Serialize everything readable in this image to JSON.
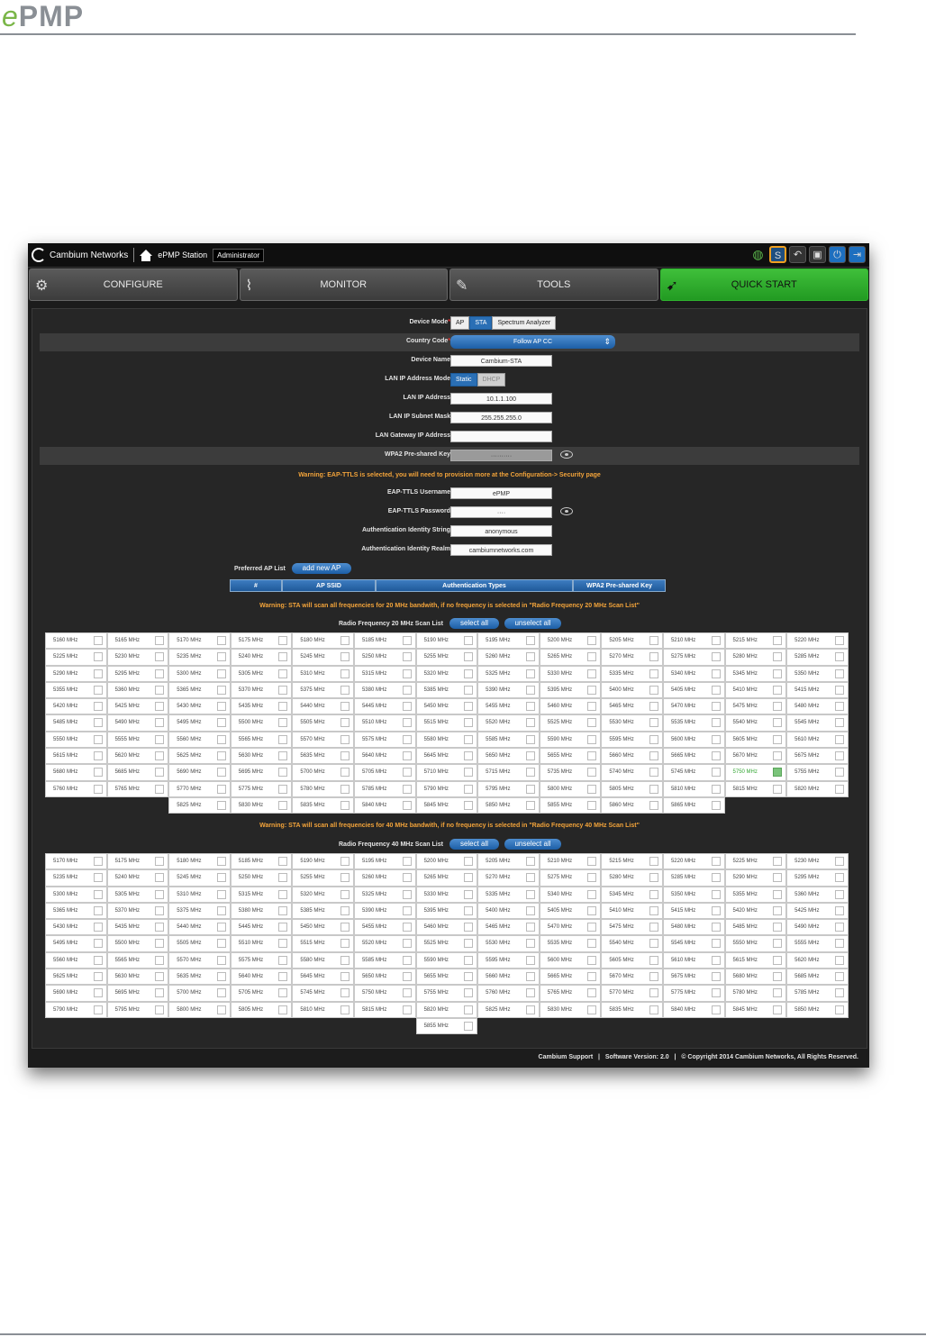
{
  "doc": {
    "logo_e": "e",
    "logo_rest": "PMP"
  },
  "topbar": {
    "brand": "Cambium Networks",
    "station": "ePMP Station",
    "role": "Administrator",
    "bulb_badge": "S"
  },
  "tabs": [
    {
      "label": "CONFIGURE"
    },
    {
      "label": "MONITOR"
    },
    {
      "label": "TOOLS"
    },
    {
      "label": "QUICK START"
    }
  ],
  "form": {
    "device_mode_label": "Device Mode",
    "device_mode_options": [
      "AP",
      "STA",
      "Spectrum Analyzer"
    ],
    "country_code_label": "Country Code",
    "country_code_value": "Follow AP CC",
    "device_name_label": "Device Name",
    "device_name_value": "Cambium-STA",
    "lan_mode_label": "LAN IP Address Mode",
    "lan_mode_options": [
      "Static",
      "DHCP"
    ],
    "lan_ip_label": "LAN IP Address",
    "lan_ip_value": "10.1.1.100",
    "subnet_label": "LAN IP Subnet Mask",
    "subnet_value": "255.255.255.0",
    "gateway_label": "LAN Gateway IP Address",
    "gateway_value": "",
    "psk_label": "WPA2 Pre-shared Key",
    "psk_value": "··········",
    "warning_eap": "Warning: EAP-TTLS is selected, you will need to provision more at the Configuration-> Security page",
    "eap_user_label": "EAP-TTLS Username",
    "eap_user_value": "ePMP",
    "eap_pass_label": "EAP-TTLS Password",
    "eap_pass_value": "····",
    "auth_id_label": "Authentication Identity String",
    "auth_id_value": "anonymous",
    "auth_realm_label": "Authentication Identity Realm",
    "auth_realm_value": "cambiumnetworks.com"
  },
  "preferred": {
    "label": "Preferred AP List",
    "add_button": "add new AP",
    "headers": [
      "#",
      "AP SSID",
      "Authentication Types",
      "WPA2 Pre-shared Key"
    ]
  },
  "scan20": {
    "warning": "Warning: STA will scan all frequencies for 20 MHz bandwith, if no frequency is selected in \"Radio Frequency 20 MHz Scan List\"",
    "title": "Radio Frequency 20 MHz Scan List",
    "select_all": "select all",
    "unselect_all": "unselect all",
    "selected": "5750 MHz",
    "rows": [
      [
        "5160 MHz",
        "5165 MHz",
        "5170 MHz",
        "5175 MHz",
        "5180 MHz",
        "5185 MHz",
        "5190 MHz",
        "5195 MHz",
        "5200 MHz",
        "5205 MHz",
        "5210 MHz",
        "5215 MHz",
        "5220 MHz"
      ],
      [
        "5225 MHz",
        "5230 MHz",
        "5235 MHz",
        "5240 MHz",
        "5245 MHz",
        "5250 MHz",
        "5255 MHz",
        "5260 MHz",
        "5265 MHz",
        "5270 MHz",
        "5275 MHz",
        "5280 MHz",
        "5285 MHz"
      ],
      [
        "5290 MHz",
        "5295 MHz",
        "5300 MHz",
        "5305 MHz",
        "5310 MHz",
        "5315 MHz",
        "5320 MHz",
        "5325 MHz",
        "5330 MHz",
        "5335 MHz",
        "5340 MHz",
        "5345 MHz",
        "5350 MHz"
      ],
      [
        "5355 MHz",
        "5360 MHz",
        "5365 MHz",
        "5370 MHz",
        "5375 MHz",
        "5380 MHz",
        "5385 MHz",
        "5390 MHz",
        "5395 MHz",
        "5400 MHz",
        "5405 MHz",
        "5410 MHz",
        "5415 MHz"
      ],
      [
        "5420 MHz",
        "5425 MHz",
        "5430 MHz",
        "5435 MHz",
        "5440 MHz",
        "5445 MHz",
        "5450 MHz",
        "5455 MHz",
        "5460 MHz",
        "5465 MHz",
        "5470 MHz",
        "5475 MHz",
        "5480 MHz"
      ],
      [
        "5485 MHz",
        "5490 MHz",
        "5495 MHz",
        "5500 MHz",
        "5505 MHz",
        "5510 MHz",
        "5515 MHz",
        "5520 MHz",
        "5525 MHz",
        "5530 MHz",
        "5535 MHz",
        "5540 MHz",
        "5545 MHz"
      ],
      [
        "5550 MHz",
        "5555 MHz",
        "5560 MHz",
        "5565 MHz",
        "5570 MHz",
        "5575 MHz",
        "5580 MHz",
        "5585 MHz",
        "5590 MHz",
        "5595 MHz",
        "5600 MHz",
        "5605 MHz",
        "5610 MHz"
      ],
      [
        "5615 MHz",
        "5620 MHz",
        "5625 MHz",
        "5630 MHz",
        "5635 MHz",
        "5640 MHz",
        "5645 MHz",
        "5650 MHz",
        "5655 MHz",
        "5660 MHz",
        "5665 MHz",
        "5670 MHz",
        "5675 MHz"
      ],
      [
        "5680 MHz",
        "5685 MHz",
        "5690 MHz",
        "5695 MHz",
        "5700 MHz",
        "5705 MHz",
        "5710 MHz",
        "5715 MHz",
        "5735 MHz",
        "5740 MHz",
        "5745 MHz",
        "5750 MHz",
        "5755 MHz"
      ],
      [
        "5760 MHz",
        "5765 MHz",
        "5770 MHz",
        "5775 MHz",
        "5780 MHz",
        "5785 MHz",
        "5790 MHz",
        "5795 MHz",
        "5800 MHz",
        "5805 MHz",
        "5810 MHz",
        "5815 MHz",
        "5820 MHz"
      ],
      [
        "",
        "",
        "5825 MHz",
        "5830 MHz",
        "5835 MHz",
        "5840 MHz",
        "5845 MHz",
        "5850 MHz",
        "5855 MHz",
        "5860 MHz",
        "5865 MHz",
        "",
        ""
      ]
    ]
  },
  "scan40": {
    "warning": "Warning: STA will scan all frequencies for 40 MHz bandwith, if no frequency is selected in \"Radio Frequency 40 MHz Scan List\"",
    "title": "Radio Frequency 40 MHz Scan List",
    "select_all": "select all",
    "unselect_all": "unselect all",
    "rows": [
      [
        "5170 MHz",
        "5175 MHz",
        "5180 MHz",
        "5185 MHz",
        "5190 MHz",
        "5195 MHz",
        "5200 MHz",
        "5205 MHz",
        "5210 MHz",
        "5215 MHz",
        "5220 MHz",
        "5225 MHz",
        "5230 MHz"
      ],
      [
        "5235 MHz",
        "5240 MHz",
        "5245 MHz",
        "5250 MHz",
        "5255 MHz",
        "5260 MHz",
        "5265 MHz",
        "5270 MHz",
        "5275 MHz",
        "5280 MHz",
        "5285 MHz",
        "5290 MHz",
        "5295 MHz"
      ],
      [
        "5300 MHz",
        "5305 MHz",
        "5310 MHz",
        "5315 MHz",
        "5320 MHz",
        "5325 MHz",
        "5330 MHz",
        "5335 MHz",
        "5340 MHz",
        "5345 MHz",
        "5350 MHz",
        "5355 MHz",
        "5360 MHz"
      ],
      [
        "5365 MHz",
        "5370 MHz",
        "5375 MHz",
        "5380 MHz",
        "5385 MHz",
        "5390 MHz",
        "5395 MHz",
        "5400 MHz",
        "5405 MHz",
        "5410 MHz",
        "5415 MHz",
        "5420 MHz",
        "5425 MHz"
      ],
      [
        "5430 MHz",
        "5435 MHz",
        "5440 MHz",
        "5445 MHz",
        "5450 MHz",
        "5455 MHz",
        "5460 MHz",
        "5465 MHz",
        "5470 MHz",
        "5475 MHz",
        "5480 MHz",
        "5485 MHz",
        "5490 MHz"
      ],
      [
        "5495 MHz",
        "5500 MHz",
        "5505 MHz",
        "5510 MHz",
        "5515 MHz",
        "5520 MHz",
        "5525 MHz",
        "5530 MHz",
        "5535 MHz",
        "5540 MHz",
        "5545 MHz",
        "5550 MHz",
        "5555 MHz"
      ],
      [
        "5560 MHz",
        "5565 MHz",
        "5570 MHz",
        "5575 MHz",
        "5580 MHz",
        "5585 MHz",
        "5590 MHz",
        "5595 MHz",
        "5600 MHz",
        "5605 MHz",
        "5610 MHz",
        "5615 MHz",
        "5620 MHz"
      ],
      [
        "5625 MHz",
        "5630 MHz",
        "5635 MHz",
        "5640 MHz",
        "5645 MHz",
        "5650 MHz",
        "5655 MHz",
        "5660 MHz",
        "5665 MHz",
        "5670 MHz",
        "5675 MHz",
        "5680 MHz",
        "5685 MHz"
      ],
      [
        "5690 MHz",
        "5695 MHz",
        "5700 MHz",
        "5705 MHz",
        "5745 MHz",
        "5750 MHz",
        "5755 MHz",
        "5760 MHz",
        "5765 MHz",
        "5770 MHz",
        "5775 MHz",
        "5780 MHz",
        "5785 MHz"
      ],
      [
        "5790 MHz",
        "5795 MHz",
        "5800 MHz",
        "5805 MHz",
        "5810 MHz",
        "5815 MHz",
        "5820 MHz",
        "5825 MHz",
        "5830 MHz",
        "5835 MHz",
        "5840 MHz",
        "5845 MHz",
        "5850 MHz"
      ],
      [
        "",
        "",
        "",
        "",
        "",
        "",
        "5855 MHz",
        "",
        "",
        "",
        "",
        "",
        ""
      ]
    ]
  },
  "footer": {
    "support": "Cambium Support",
    "version_label": "Software Version:",
    "version": "2.0",
    "copyright": "© Copyright 2014 Cambium Networks, All Rights Reserved."
  },
  "colors": {
    "accent": "#2a6fb5",
    "quick_start": "#2fb52f",
    "warning": "#f2a33a"
  }
}
